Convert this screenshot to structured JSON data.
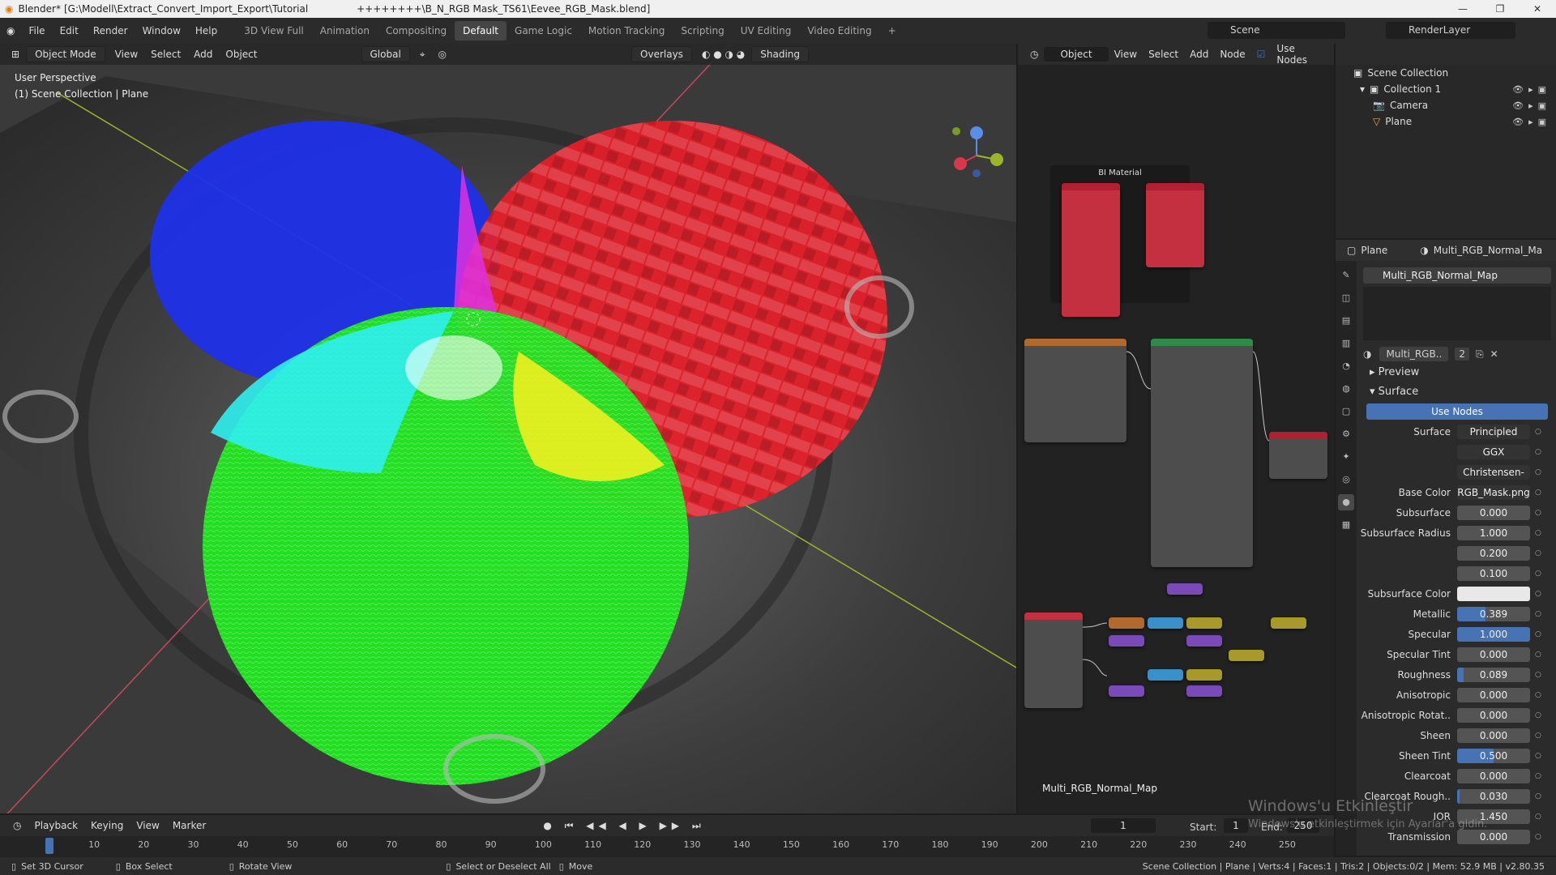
{
  "window": {
    "app": "Blender*",
    "path": "[G:\\Modell\\Extract_Convert_Import_Export\\Tutorial",
    "file": "++++++++\\B_N_RGB Mask_TS61\\Eevee_RGB_Mask.blend]"
  },
  "menu": [
    "File",
    "Edit",
    "Render",
    "Window",
    "Help"
  ],
  "workspaces": [
    "3D View Full",
    "Animation",
    "Compositing",
    "Default",
    "Game Logic",
    "Motion Tracking",
    "Scripting",
    "UV Editing",
    "Video Editing"
  ],
  "active_workspace": "Default",
  "scene": "Scene",
  "render_layer": "RenderLayer",
  "viewport": {
    "mode": "Object Mode",
    "menus": [
      "View",
      "Select",
      "Add",
      "Object"
    ],
    "orientation": "Global",
    "overlays": "Overlays",
    "shading": "Shading",
    "perspective": "User Perspective",
    "collection_info": "(1) Scene Collection | Plane"
  },
  "node_editor": {
    "type": "Object",
    "menus": [
      "View",
      "Select",
      "Add",
      "Node"
    ],
    "use_nodes": "Use Nodes",
    "material_name": "Multi_RGB_Normal_Map",
    "frame_title": "BI Material"
  },
  "outliner": {
    "root": "Scene Collection",
    "items": [
      "Collection 1",
      "Camera",
      "Plane"
    ]
  },
  "properties": {
    "object": "Plane",
    "material": "Multi_RGB_Normal_Ma",
    "slot": "Multi_RGB_Normal_Map",
    "mat_short": "Multi_RGB..",
    "users": "2",
    "preview": "Preview",
    "surface_section": "Surface",
    "use_nodes": "Use Nodes",
    "rows": [
      {
        "label": "Surface",
        "value": "Principled BSDF",
        "style": "dark"
      },
      {
        "label": "",
        "value": "GGX",
        "style": "dark"
      },
      {
        "label": "",
        "value": "Christensen-Burl..",
        "style": "dark"
      },
      {
        "label": "Base Color",
        "value": "RGB_Mask.png",
        "style": "dark"
      },
      {
        "label": "Subsurface",
        "value": "0.000",
        "style": "plain"
      },
      {
        "label": "Subsurface Radius",
        "value": "1.000",
        "style": "plain"
      },
      {
        "label": "",
        "value": "0.200",
        "style": "plain"
      },
      {
        "label": "",
        "value": "0.100",
        "style": "plain"
      },
      {
        "label": "Subsurface Color",
        "value": "",
        "style": "white"
      },
      {
        "label": "Metallic",
        "value": "0.389",
        "style": "fill",
        "fill": 0.389
      },
      {
        "label": "Specular",
        "value": "1.000",
        "style": "fill",
        "fill": 1.0
      },
      {
        "label": "Specular Tint",
        "value": "0.000",
        "style": "plain"
      },
      {
        "label": "Roughness",
        "value": "0.089",
        "style": "fill",
        "fill": 0.089
      },
      {
        "label": "Anisotropic",
        "value": "0.000",
        "style": "plain"
      },
      {
        "label": "Anisotropic Rotat..",
        "value": "0.000",
        "style": "plain"
      },
      {
        "label": "Sheen",
        "value": "0.000",
        "style": "plain"
      },
      {
        "label": "Sheen Tint",
        "value": "0.500",
        "style": "fill",
        "fill": 0.5
      },
      {
        "label": "Clearcoat",
        "value": "0.000",
        "style": "plain"
      },
      {
        "label": "Clearcoat Rough..",
        "value": "0.030",
        "style": "fill",
        "fill": 0.03
      },
      {
        "label": "IOR",
        "value": "1.450",
        "style": "plain"
      },
      {
        "label": "Transmission",
        "value": "0.000",
        "style": "plain"
      }
    ]
  },
  "timeline": {
    "menus": [
      "Playback",
      "Keying",
      "View",
      "Marker"
    ],
    "current_frame": "1",
    "start_label": "Start:",
    "start": "1",
    "end_label": "End:",
    "end": "250",
    "ticks": [
      "10",
      "20",
      "30",
      "40",
      "50",
      "60",
      "70",
      "80",
      "90",
      "100",
      "110",
      "120",
      "130",
      "140",
      "150",
      "160",
      "170",
      "180",
      "190",
      "200",
      "210",
      "220",
      "230",
      "240",
      "250"
    ]
  },
  "status": {
    "hint1": "Set 3D Cursor",
    "hint2": "Box Select",
    "hint3": "Rotate View",
    "hint4": "Select or Deselect All",
    "hint5": "Move",
    "stats": "Scene Collection | Plane | Verts:4 | Faces:1 | Tris:2 | Objects:0/2 | Mem: 52.9 MB | v2.80.35"
  },
  "watermark": {
    "line1": "Windows'u Etkinleştir",
    "line2": "Windows'u etkinleştirmek için Ayarlar'a gidin."
  }
}
